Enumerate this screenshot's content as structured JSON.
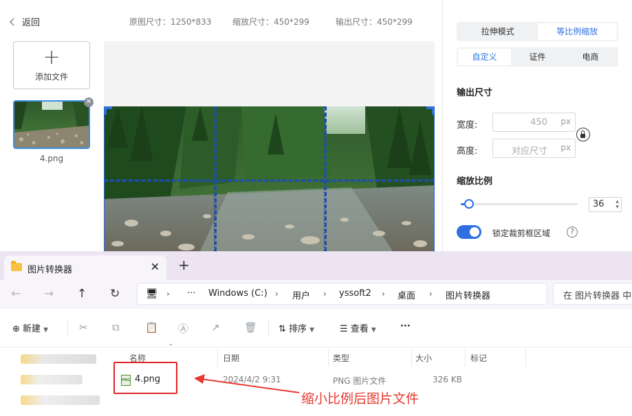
{
  "app": {
    "back_label": "返回",
    "original_size": "原图尺寸：1250*833",
    "scaled_size": "缩放尺寸：450*299",
    "output_size": "输出尺寸：450*299",
    "add_file_label": "添加文件",
    "file_name": "4.png",
    "mode_tabs": [
      "拉伸模式",
      "等比例缩放"
    ],
    "preset_tabs": [
      "自定义",
      "证件",
      "电商"
    ],
    "output_title": "输出尺寸",
    "width_label": "宽度:",
    "width_value": "450",
    "height_label": "高度:",
    "height_placeholder": "对应尺寸",
    "unit": "px",
    "scale_title": "缩放比例",
    "scale_value": "36",
    "lock_crop_label": "锁定裁剪框区域",
    "accent_color": "#2f6fe0"
  },
  "explorer": {
    "tab_title": "图片转换器",
    "breadcrumb": [
      "Windows (C:)",
      "用户",
      "yssoft2",
      "桌面",
      "图片转换器"
    ],
    "search_placeholder": "在 图片转换器 中",
    "toolbar": {
      "new_label": "新建",
      "sort_label": "排序",
      "view_label": "查看",
      "more_label": "···"
    },
    "columns": [
      "名称",
      "日期",
      "类型",
      "大小",
      "标记"
    ],
    "files": [
      {
        "name": "4.png",
        "date": "2024/4/2 9:31",
        "type": "PNG 图片文件",
        "size": "326 KB"
      }
    ]
  },
  "annotation": {
    "text": "缩小比例后图片文件",
    "color": "#e8382f"
  }
}
